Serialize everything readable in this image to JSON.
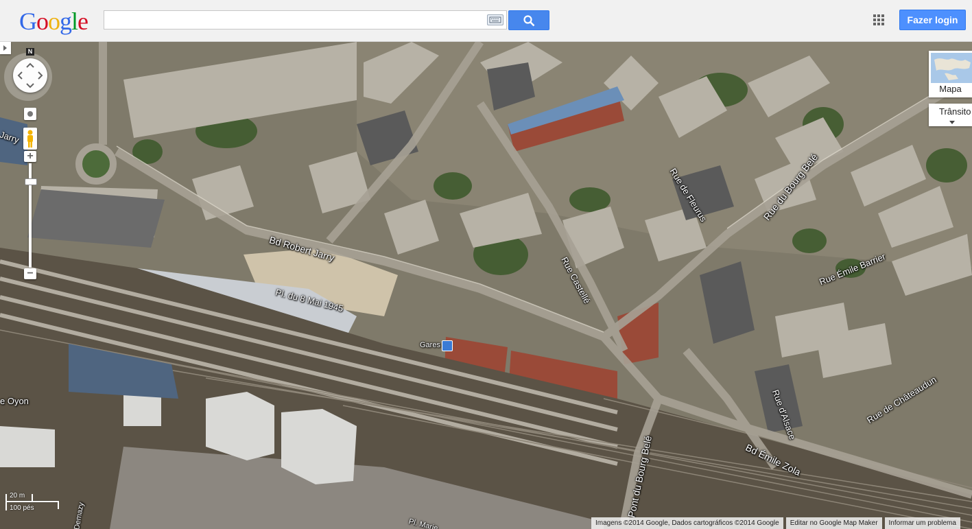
{
  "header": {
    "logo_letters": [
      {
        "ch": "G",
        "color": "#3369e8"
      },
      {
        "ch": "o",
        "color": "#d50f25"
      },
      {
        "ch": "o",
        "color": "#eeb211"
      },
      {
        "ch": "g",
        "color": "#3369e8"
      },
      {
        "ch": "l",
        "color": "#009925"
      },
      {
        "ch": "e",
        "color": "#d50f25"
      }
    ],
    "search_value": "",
    "search_icon": "magnifier-icon",
    "keyboard_icon": "keyboard-icon",
    "apps_icon": "apps-grid-icon",
    "login_label": "Fazer login"
  },
  "controls": {
    "compass_label": "N",
    "zoom_in": "+",
    "zoom_out": "−",
    "map_type_label": "Mapa",
    "traffic_label": "Trânsito"
  },
  "map_labels": {
    "bd_robert_jarry": "Bd Robert Jarry",
    "pl_8_mai": "Pl. du 8 Mai 1945",
    "rue_castelle": "Rue Castellé",
    "rue_fleurus": "Rue de Fleurus",
    "rue_bourg_bele": "Rue du Bourg Belé",
    "rue_emile_barrier": "Rue Émile Barrier",
    "rue_alsace": "Rue d'Alsace",
    "rue_chateaudun": "Rue de Châteaudun",
    "bd_emile_zola": "Bd Émile Zola",
    "pont_bourg_bele": "Pont du Bourg Belé",
    "gares": "Gares",
    "jarry": "Jarry",
    "oyon": "e Oyon",
    "demazy": "Demazy",
    "pl_marie": "Pl. Marie"
  },
  "scale": {
    "metric": "20 m",
    "imperial": "100 pés"
  },
  "footer": {
    "attribution": "Imagens ©2014 Google, Dados cartográficos ©2014 Google",
    "edit": "Editar no Google Map Maker",
    "report": "Informar um problema"
  }
}
